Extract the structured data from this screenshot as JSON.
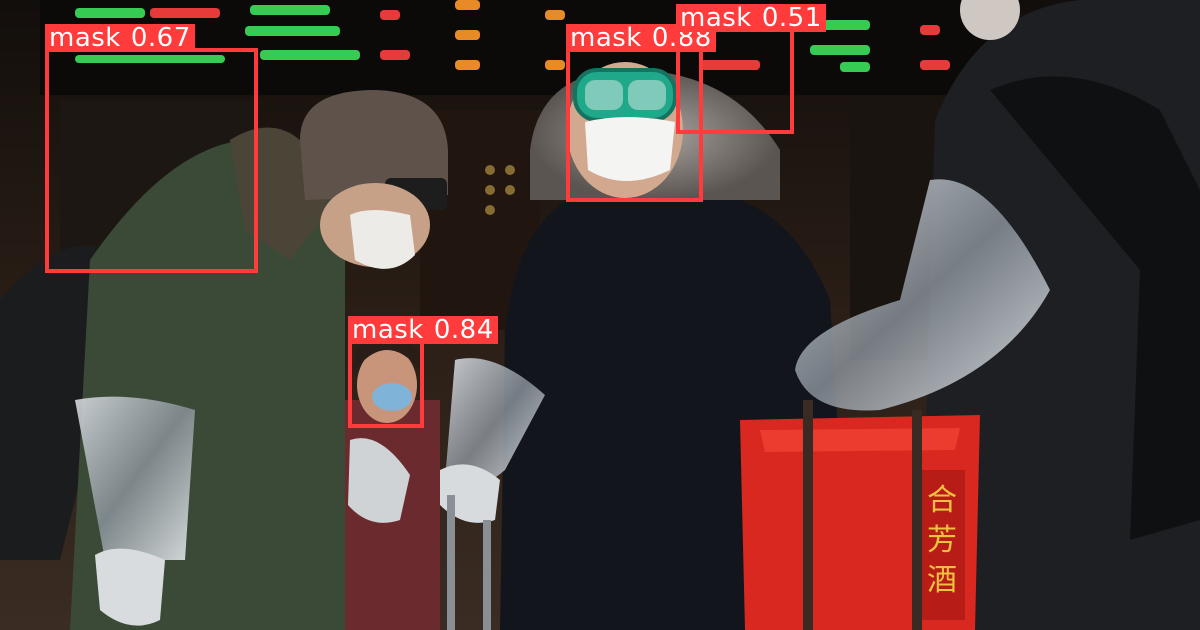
{
  "palette": {
    "box": "#ff3b3b",
    "label_text": "#ffffff",
    "board_green": "#3be05a",
    "board_red": "#ff4040",
    "board_orange": "#ff9a2a"
  },
  "detections": [
    {
      "label": "mask",
      "score": "0.67"
    },
    {
      "label": "mask",
      "score": "0.88"
    },
    {
      "label": "mask",
      "score": "0.51"
    },
    {
      "label": "mask",
      "score": "0.84"
    }
  ]
}
